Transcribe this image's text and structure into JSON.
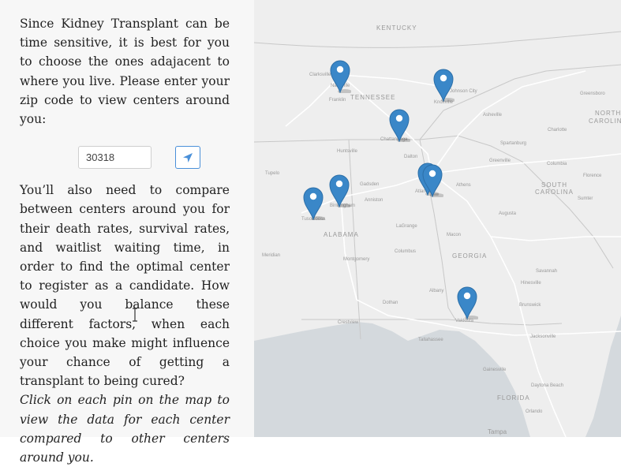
{
  "sidebar": {
    "intro": "Since Kidney Transplant can be time sensitive, it is best for you to choose the ones adajacent to where you live. Please enter your zip code to view centers around you:",
    "zip_value": "30318",
    "second": "You’ll also need to compare between centers around you for their death rates, survival rates, and waitlist waiting time, in order to find the optimal center to register as a candidate. How would you balance these different factors, when each choice you make might influence your chance of getting a transplant to being cured?",
    "third": "Click on each pin on the map to view the data for each center compared to other centers around you."
  },
  "map": {
    "states": {
      "kentucky": "KENTUCKY",
      "tennessee": "TENNESSEE",
      "north_carolina_1": "NORTH",
      "north_carolina_2": "CAROLINA",
      "south_carolina_1": "SOUTH",
      "south_carolina_2": "CAROLINA",
      "alabama": "ALABAMA",
      "georgia": "GEORGIA",
      "florida": "FLORIDA"
    },
    "cities": {
      "clarksville": "Clarksville",
      "nashville": "Nashville",
      "franklin": "Franklin",
      "knoxville": "Knoxville",
      "johnson_city": "Johnson City",
      "greensboro": "Greensboro",
      "asheville": "Asheville",
      "charlotte": "Charlotte",
      "chattanooga": "Chattanooga",
      "spartanburg": "Spartanburg",
      "huntsville": "Huntsville",
      "tupelo": "Tupelo",
      "gadsden": "Gadsden",
      "atlanta": "Atlanta",
      "athens": "Athens",
      "greenville": "Greenville",
      "columbia": "Columbia",
      "florence": "Florence",
      "birmingham": "Birmingham",
      "tuscaloosa": "Tuscaloosa",
      "anniston": "Anniston",
      "lagrange": "LaGrange",
      "augusta": "Augusta",
      "macon": "Macon",
      "meridian": "Meridian",
      "montgomery": "Montgomery",
      "columbus": "Columbus",
      "savannah": "Savannah",
      "dothan": "Dothan",
      "albany": "Albany",
      "valdosta": "Valdosta",
      "brunswick": "Brunswick",
      "crestview": "Crestview",
      "tallahassee": "Tallahassee",
      "jacksonville": "Jacksonville",
      "gainesville": "Gainesville",
      "daytona": "Daytona Beach",
      "orlando": "Orlando",
      "tampa": "Tampa",
      "sumter": "Sumter",
      "hinesville": "Hinesville",
      "dalton": "Dalton"
    },
    "pin_color": "#3a87c8",
    "pin_icon": "map-marker-icon"
  },
  "colors": {
    "sidebar_bg": "#f7f7f7",
    "map_land": "#eeeeee",
    "map_water": "#d4d9dd",
    "accent": "#4a90d9"
  }
}
